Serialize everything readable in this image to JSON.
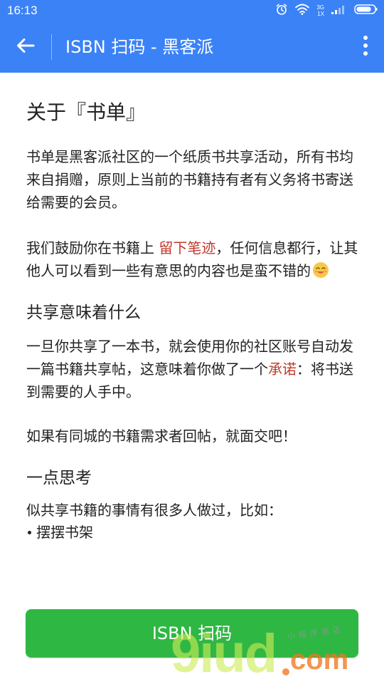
{
  "status_bar": {
    "time": "16:13",
    "net_top": "3G",
    "net_bottom": "1X",
    "icons": [
      "alarm-icon",
      "wifi-icon",
      "signal-icon",
      "battery-icon"
    ]
  },
  "app_bar": {
    "title": "ISBN 扫码 - 黑客派",
    "back_icon": "arrow-left-icon",
    "menu_icon": "more-vertical-icon"
  },
  "content": {
    "heading_about": "关于『书单』",
    "para_1": "书单是黑客派社区的一个纸质书共享活动，所有书均来自捐赠，原则上当前的书籍持有者有义务将书寄送给需要的会员。",
    "para_2_before": "我们鼓励你在书籍上 ",
    "para_2_highlight": "留下笔迹",
    "para_2_after": "，任何信息都行，让其他人可以看到一些有意思的内容也是蛮不错的",
    "emoji": "smiling-face-icon",
    "heading_share": "共享意味着什么",
    "para_3_before": "一旦你共享了一本书，就会使用你的社区账号自动发一篇书籍共享帖，这意味着你做了一个",
    "para_3_highlight": "承诺",
    "para_3_after": "：将书送到需要的人手中。",
    "para_4": "如果有同城的书籍需求者回帖，就面交吧！",
    "heading_think": "一点思考",
    "para_5": "似共享书籍的事情有很多人做过，比如：",
    "bullet_1": "摆摆书架"
  },
  "button": {
    "label": "ISBN 扫码"
  },
  "watermark": {
    "main": "9iud",
    "domain": "com",
    "sub": "小程序商店"
  },
  "colors": {
    "primary": "#3b82f6",
    "button": "#2fb744",
    "highlight": "#c0392b",
    "text": "#222222"
  }
}
